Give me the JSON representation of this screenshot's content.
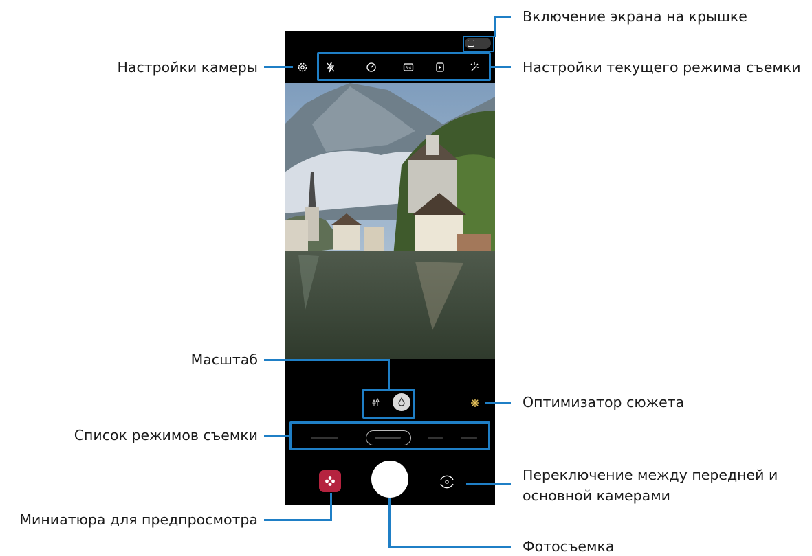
{
  "callouts": {
    "cover_screen": "Включение экрана на крышке",
    "camera_settings": "Настройки камеры",
    "mode_settings": "Настройки текущего режима съемки",
    "zoom": "Масштаб",
    "scene_optimizer": "Оптимизатор сюжета",
    "mode_list": "Список режимов съемки",
    "switch_camera_line1": "Переключение между передней и",
    "switch_camera_line2": "основной камерами",
    "preview_thumbnail": "Миниатюра для предпросмотра",
    "take_photo": "Фотосъемка"
  },
  "camera_ui": {
    "top_icons": [
      "gear-icon",
      "flash-off-icon",
      "timer-icon",
      "aspect-ratio-icon",
      "motion-photo-icon",
      "filter-icon"
    ],
    "zoom_buttons": [
      "wide-angle-icon",
      "standard-zoom-icon"
    ],
    "modes": [
      "",
      "",
      "",
      ""
    ],
    "selected_mode_index": 1
  },
  "colors": {
    "callout_line": "#1f7fc6",
    "thumbnail": "#b5233f",
    "scene_optimizer": "#e8c35a"
  }
}
